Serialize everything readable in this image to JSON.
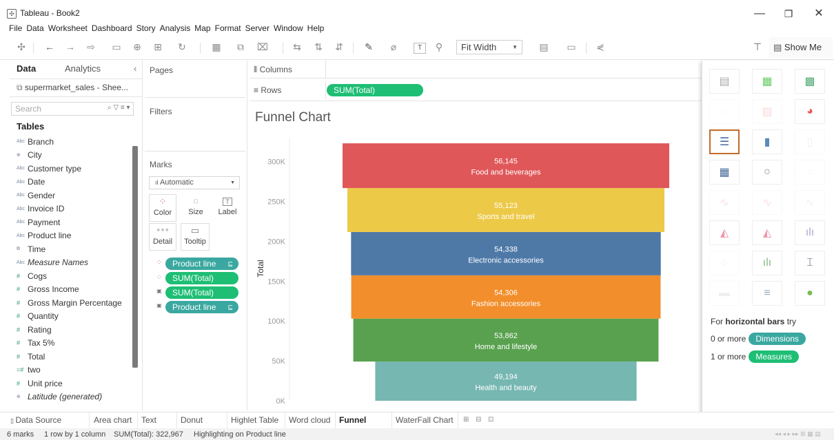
{
  "window": {
    "title": "Tableau - Book2",
    "minimize": "—",
    "maximize": "❐",
    "close": "✕"
  },
  "menu": [
    "File",
    "Data",
    "Worksheet",
    "Dashboard",
    "Story",
    "Analysis",
    "Map",
    "Format",
    "Server",
    "Window",
    "Help"
  ],
  "toolbar": {
    "fit": "Fit Width",
    "show_me": "Show Me"
  },
  "data_pane": {
    "tab_data": "Data",
    "tab_analytics": "Analytics",
    "collapse": "‹",
    "datasource": "supermarket_sales - Shee...",
    "search_placeholder": "Search",
    "tables_label": "Tables",
    "fields": [
      {
        "name": "Branch",
        "type": "Abc"
      },
      {
        "name": "City",
        "type": "⊕"
      },
      {
        "name": "Customer type",
        "type": "Abc"
      },
      {
        "name": "Date",
        "type": "Abc"
      },
      {
        "name": "Gender",
        "type": "Abc"
      },
      {
        "name": "Invoice ID",
        "type": "Abc"
      },
      {
        "name": "Payment",
        "type": "Abc"
      },
      {
        "name": "Product line",
        "type": "Abc"
      },
      {
        "name": "Time",
        "type": "⧉"
      },
      {
        "name": "Measure Names",
        "type": "Abc"
      },
      {
        "name": "Cogs",
        "type": "#"
      },
      {
        "name": "Gross Income",
        "type": "#"
      },
      {
        "name": "Gross Margin Percentage",
        "type": "#"
      },
      {
        "name": "Quantity",
        "type": "#"
      },
      {
        "name": "Rating",
        "type": "#"
      },
      {
        "name": "Tax 5%",
        "type": "#"
      },
      {
        "name": "Total",
        "type": "#"
      },
      {
        "name": "two",
        "type": "=#"
      },
      {
        "name": "Unit price",
        "type": "#"
      },
      {
        "name": "Latitude (generated)",
        "type": "⊕"
      }
    ]
  },
  "cards": {
    "pages": "Pages",
    "filters": "Filters",
    "marks": "Marks",
    "mark_type": "Automatic",
    "mark_buttons": [
      "Color",
      "Size",
      "Label",
      "Detail",
      "Tooltip"
    ],
    "mark_pills": [
      "Product line",
      "SUM(Total)",
      "SUM(Total)",
      "Product line"
    ]
  },
  "shelves": {
    "columns": "Columns",
    "rows": "Rows",
    "rows_pill": "SUM(Total)"
  },
  "chart_data": {
    "type": "bar",
    "title": "Funnel Chart",
    "ylabel": "Total",
    "xlabel": "",
    "ylim": [
      0,
      330000
    ],
    "y_ticks": [
      "0K",
      "50K",
      "100K",
      "150K",
      "200K",
      "250K",
      "300K"
    ],
    "categories": [
      "Food and beverages",
      "Sports and travel",
      "Electronic accessories",
      "Fashion accessories",
      "Home and lifestyle",
      "Health and beauty"
    ],
    "values": [
      56145,
      55123,
      54338,
      54306,
      53862,
      49194
    ],
    "value_labels": [
      "56,145",
      "55,123",
      "54,338",
      "54,306",
      "53,862",
      "49,194"
    ],
    "colors": [
      "#e05759",
      "#edc948",
      "#4e79a7",
      "#f28e2b",
      "#59a14f",
      "#76b7b2"
    ]
  },
  "show_me": {
    "hint_prefix": "For ",
    "hint_bold": "horizontal bars",
    "hint_suffix": " try",
    "dim_prefix": "0 or more",
    "dim_pill": "Dimensions",
    "meas_prefix": "1 or more",
    "meas_pill": "Measures"
  },
  "tabs": {
    "data_source": "Data Source",
    "sheets": [
      "Area chart",
      "Text chart",
      "Donut chart",
      "Highlet Table",
      "Word cloud",
      "Funnel Chart",
      "WaterFall Chart"
    ],
    "active": "Funnel Chart"
  },
  "status": {
    "marks": "6 marks",
    "dims": "1 row by 1 column",
    "sum": "SUM(Total): 322,967",
    "highlight": "Highlighting on Product line"
  }
}
